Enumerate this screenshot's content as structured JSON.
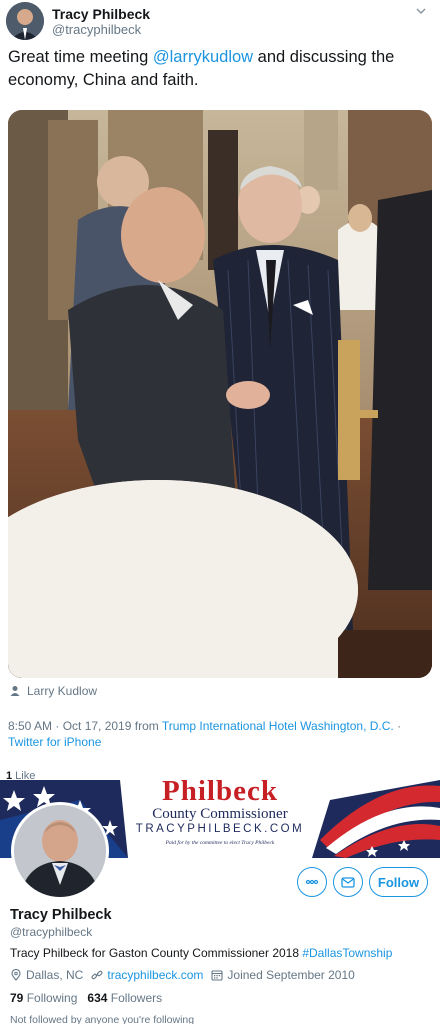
{
  "tweet": {
    "author_name": "Tracy Philbeck",
    "author_handle": "@tracyphilbeck",
    "text_before": "Great time meeting ",
    "mention": "@larrykudlow",
    "text_after": " and discussing the economy, China and faith.",
    "photo_icon": "handshake-photo",
    "tagged_person": "Larry Kudlow",
    "time": "8:50 AM · Oct 17, 2019",
    "from_word": " from ",
    "location": "Trump International Hotel Washington, D.C.",
    "separator": " · ",
    "client": "Twitter for iPhone",
    "likes_count": "1",
    "likes_label": " Like"
  },
  "profile": {
    "banner_title": "Philbeck",
    "banner_subtitle": "County Commissioner",
    "banner_site": "TRACYPHILBECK.COM",
    "banner_paid": "Paid for by the committee to elect Tracy Philbeck",
    "name": "Tracy Philbeck",
    "handle": "@tracyphilbeck",
    "bio_text": "Tracy Philbeck for Gaston County Commissioner 2018 ",
    "bio_hashtag": "#DallasTownship",
    "location": "Dallas, NC",
    "website": "tracyphilbeck.com",
    "joined": "Joined September 2010",
    "following_count": "79",
    "following_label": "Following",
    "followers_count": "634",
    "followers_label": "Followers",
    "note": "Not followed by anyone you're following",
    "follow_label": "Follow"
  },
  "colors": {
    "accent": "#1b95e0",
    "banner_red": "#c61f24",
    "banner_navy": "#1f2a5c"
  }
}
